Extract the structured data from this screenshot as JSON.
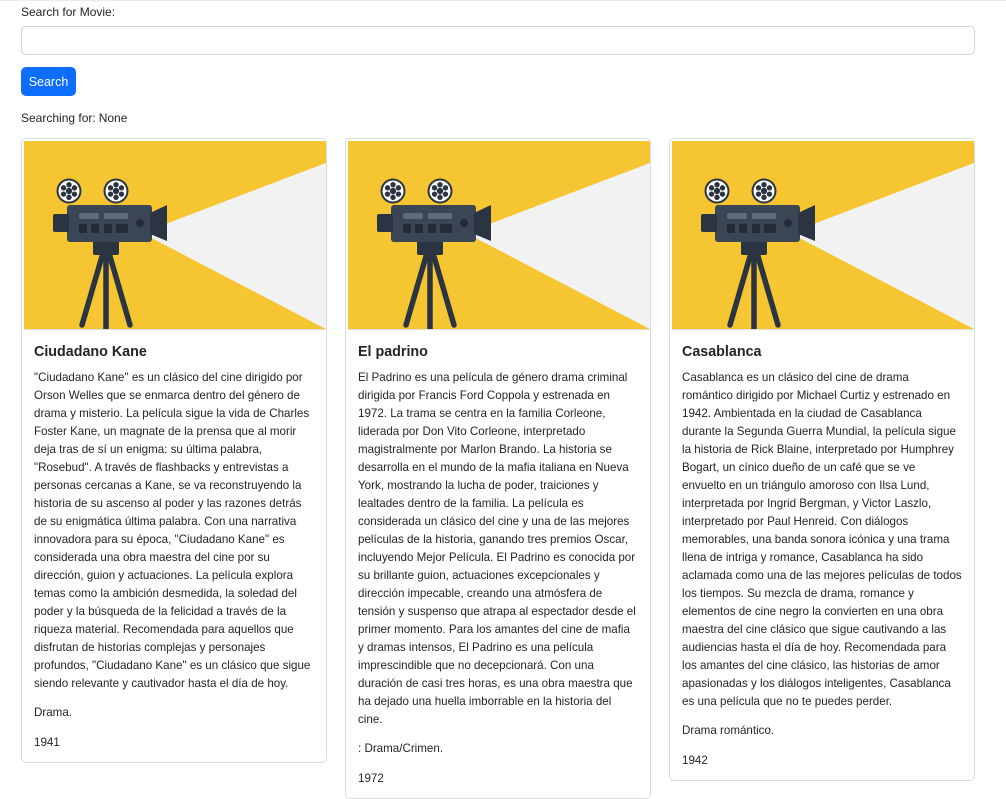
{
  "search": {
    "label": "Search for Movie:",
    "value": "",
    "placeholder": "",
    "button_label": "Search",
    "status_prefix": "Searching for:",
    "status_value": "None"
  },
  "colors": {
    "primary": "#0d6efd",
    "poster_yellow": "#f6c532",
    "poster_bg": "#eeeeee",
    "camera_dark": "#2b3541"
  },
  "poster_icon": "movie-camera-on-tripod-icon",
  "movies": [
    {
      "title": "Ciudadano Kane",
      "description": "\"Ciudadano Kane\" es un clásico del cine dirigido por Orson Welles que se enmarca dentro del género de drama y misterio. La película sigue la vida de Charles Foster Kane, un magnate de la prensa que al morir deja tras de sí un enigma: su última palabra, \"Rosebud\". A través de flashbacks y entrevistas a personas cercanas a Kane, se va reconstruyendo la historia de su ascenso al poder y las razones detrás de su enigmática última palabra. Con una narrativa innovadora para su época, \"Ciudadano Kane\" es considerada una obra maestra del cine por su dirección, guion y actuaciones. La película explora temas como la ambición desmedida, la soledad del poder y la búsqueda de la felicidad a través de la riqueza material. Recomendada para aquellos que disfrutan de historias complejas y personajes profundos, \"Ciudadano Kane\" es un clásico que sigue siendo relevante y cautivador hasta el día de hoy.",
      "genre": "Drama.",
      "year": "1941"
    },
    {
      "title": "El padrino",
      "description": "El Padrino es una película de género drama criminal dirigida por Francis Ford Coppola y estrenada en 1972. La trama se centra en la familia Corleone, liderada por Don Vito Corleone, interpretado magistralmente por Marlon Brando. La historia se desarrolla en el mundo de la mafia italiana en Nueva York, mostrando la lucha de poder, traiciones y lealtades dentro de la familia. La película es considerada un clásico del cine y una de las mejores películas de la historia, ganando tres premios Oscar, incluyendo Mejor Película. El Padrino es conocida por su brillante guion, actuaciones excepcionales y dirección impecable, creando una atmósfera de tensión y suspenso que atrapa al espectador desde el primer momento. Para los amantes del cine de mafia y dramas intensos, El Padrino es una película imprescindible que no decepcionará. Con una duración de casi tres horas, es una obra maestra que ha dejado una huella imborrable en la historia del cine.",
      "genre": ": Drama/Crimen.",
      "year": "1972"
    },
    {
      "title": "Casablanca",
      "description": "Casablanca es un clásico del cine de drama romántico dirigido por Michael Curtiz y estrenado en 1942. Ambientada en la ciudad de Casablanca durante la Segunda Guerra Mundial, la película sigue la historia de Rick Blaine, interpretado por Humphrey Bogart, un cínico dueño de un café que se ve envuelto en un triángulo amoroso con Ilsa Lund, interpretada por Ingrid Bergman, y Victor Laszlo, interpretado por Paul Henreid. Con diálogos memorables, una banda sonora icónica y una trama llena de intriga y romance, Casablanca ha sido aclamada como una de las mejores películas de todos los tiempos. Su mezcla de drama, romance y elementos de cine negro la convierten en una obra maestra del cine clásico que sigue cautivando a las audiencias hasta el día de hoy. Recomendada para los amantes del cine clásico, las historias de amor apasionadas y los diálogos inteligentes, Casablanca es una película que no te puedes perder.",
      "genre": "Drama romántico.",
      "year": "1942"
    }
  ]
}
